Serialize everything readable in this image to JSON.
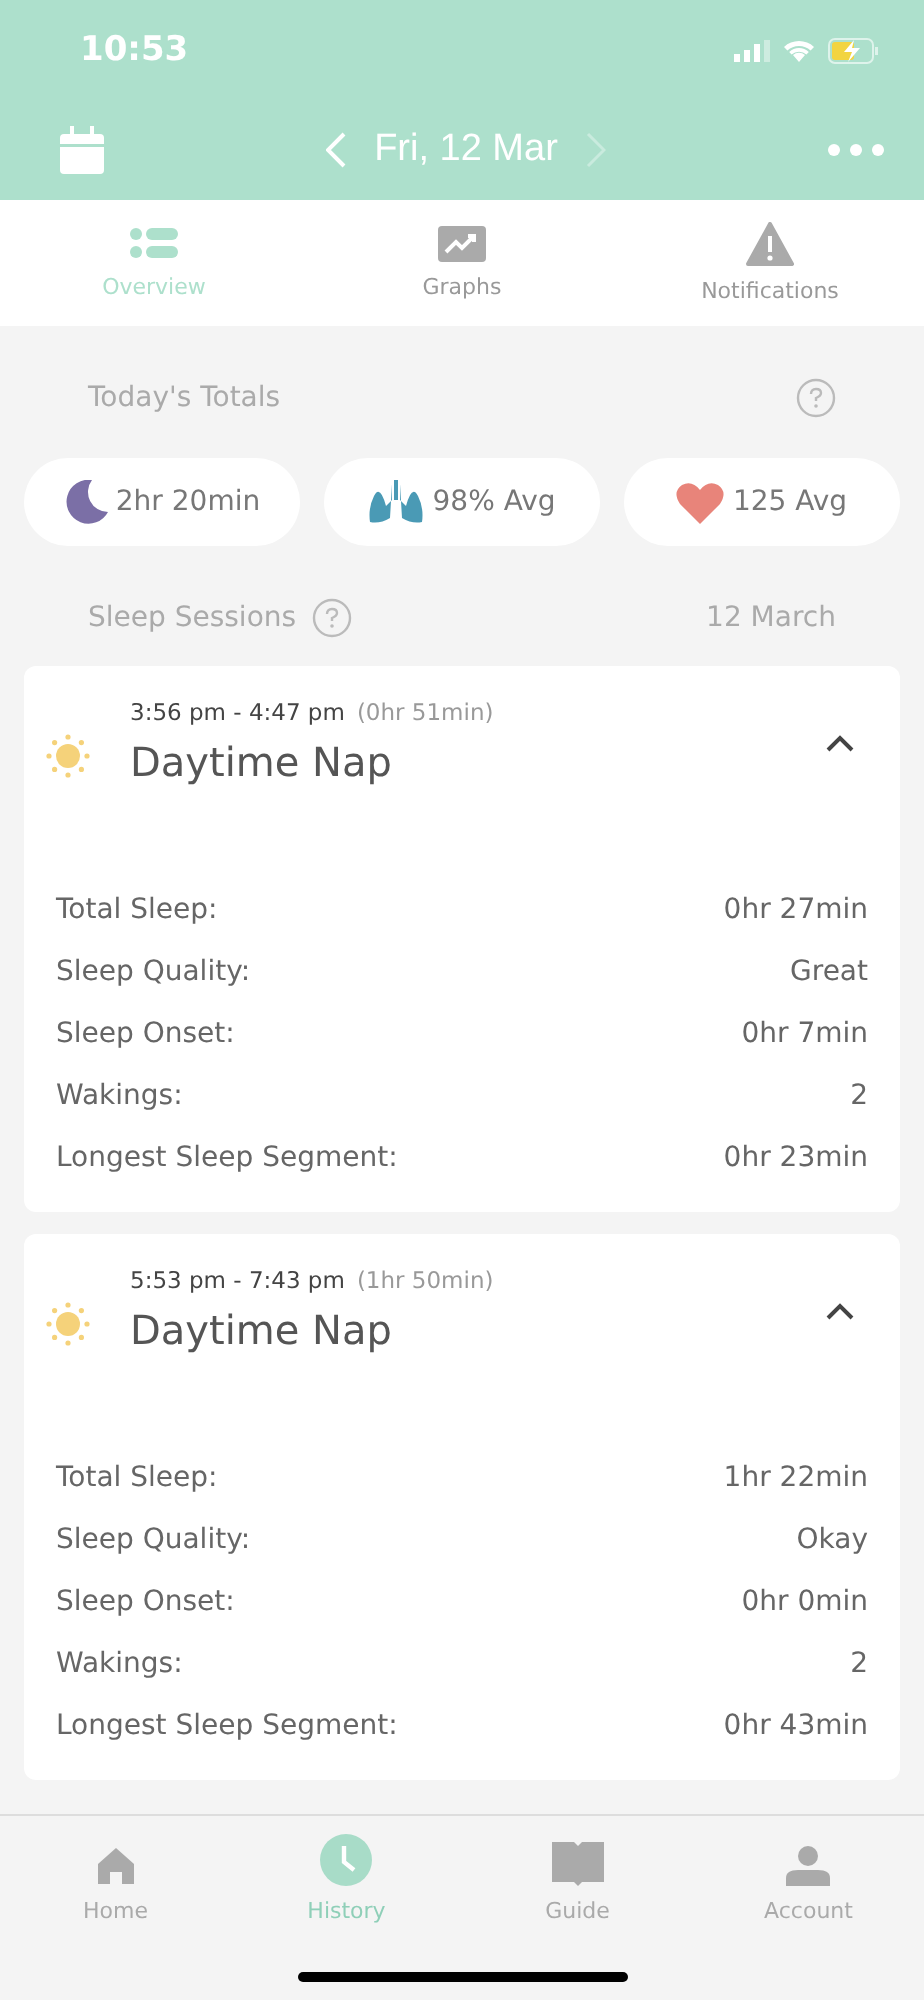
{
  "status_bar": {
    "time": "10:53"
  },
  "header": {
    "date": "Fri, 12 Mar"
  },
  "tabs": [
    {
      "label": "Overview",
      "selected": true
    },
    {
      "label": "Graphs",
      "selected": false
    },
    {
      "label": "Notifications",
      "selected": false
    }
  ],
  "totals": {
    "title": "Today's Totals",
    "items": [
      {
        "kind": "sleep",
        "value": "2hr 20min"
      },
      {
        "kind": "oxygen",
        "value": "98% Avg"
      },
      {
        "kind": "heart",
        "value": "125 Avg"
      }
    ]
  },
  "sessions": {
    "title": "Sleep Sessions",
    "date": "12 March",
    "items": [
      {
        "time": "3:56 pm - 4:47 pm",
        "duration": "(0hr 51min)",
        "title": "Daytime Nap",
        "expanded": true,
        "stats": [
          {
            "label": "Total Sleep:",
            "value": "0hr 27min"
          },
          {
            "label": "Sleep Quality:",
            "value": "Great"
          },
          {
            "label": "Sleep Onset:",
            "value": "0hr 7min"
          },
          {
            "label": "Wakings:",
            "value": "2"
          },
          {
            "label": "Longest Sleep Segment:",
            "value": "0hr 23min"
          }
        ]
      },
      {
        "time": "5:53 pm - 7:43 pm",
        "duration": "(1hr 50min)",
        "title": "Daytime Nap",
        "expanded": true,
        "stats": [
          {
            "label": "Total Sleep:",
            "value": "1hr 22min"
          },
          {
            "label": "Sleep Quality:",
            "value": "Okay"
          },
          {
            "label": "Sleep Onset:",
            "value": "0hr 0min"
          },
          {
            "label": "Wakings:",
            "value": "2"
          },
          {
            "label": "Longest Sleep Segment:",
            "value": "0hr 43min"
          }
        ]
      }
    ]
  },
  "nav": [
    {
      "label": "Home",
      "selected": false
    },
    {
      "label": "History",
      "selected": true
    },
    {
      "label": "Guide",
      "selected": false
    },
    {
      "label": "Account",
      "selected": false
    }
  ]
}
